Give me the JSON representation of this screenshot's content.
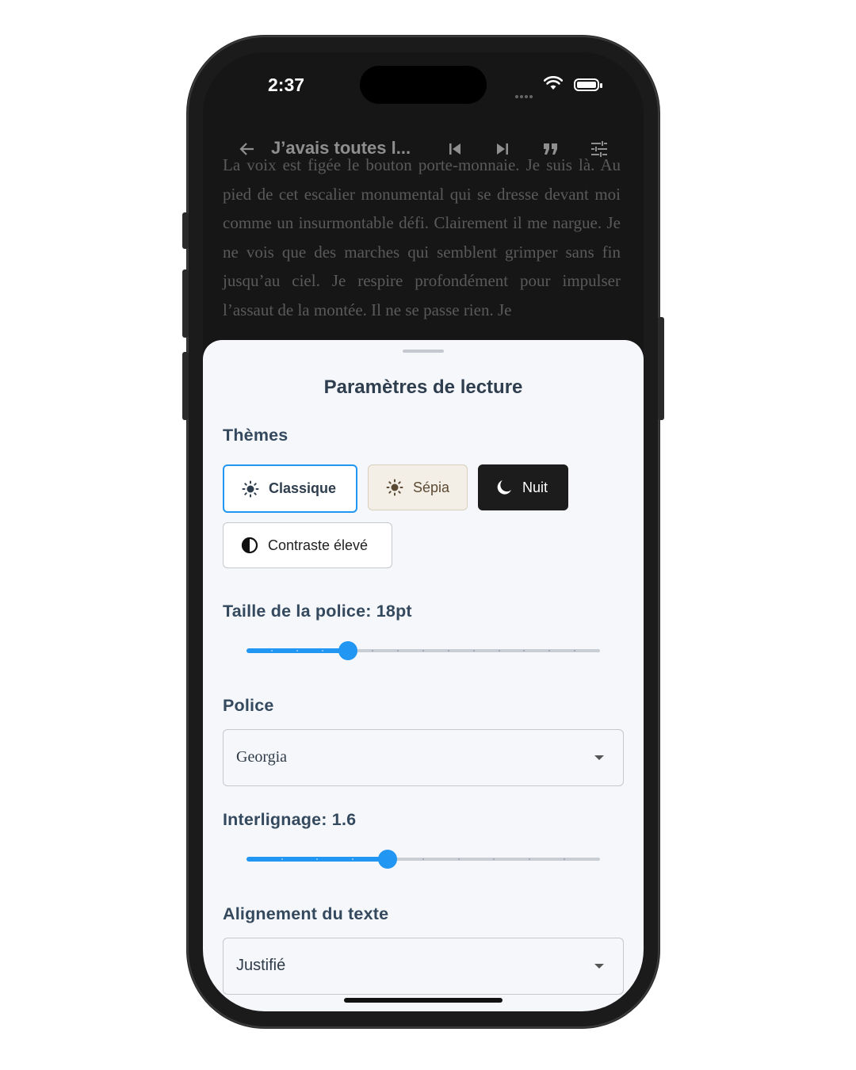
{
  "status_bar": {
    "time": "2:37"
  },
  "top_bar": {
    "back_icon": "arrow-left-icon",
    "title": "J’avais toutes l...",
    "actions": [
      "skip-previous-icon",
      "skip-next-icon",
      "quote-icon",
      "settings-sliders-icon"
    ]
  },
  "reading": {
    "text": "La voix est figée le bouton porte-monnaie. Je suis là. Au pied de cet escalier monumental qui se dresse devant moi comme un insurmontable défi. Clairement il me nargue. Je ne vois que des marches qui semblent grimper sans fin jusqu’au ciel. Je respire profondément pour impulser l’assaut de la montée. Il ne se passe rien. Je"
  },
  "sheet": {
    "title": "Paramètres de lecture",
    "themes_label": "Thèmes",
    "themes": [
      {
        "label": "Classique",
        "icon": "sun-icon",
        "selected": true
      },
      {
        "label": "Sépia",
        "icon": "sun-icon",
        "selected": false
      },
      {
        "label": "Nuit",
        "icon": "moon-icon",
        "selected": false
      },
      {
        "label": "Contraste élevé",
        "icon": "contrast-icon",
        "selected": false
      }
    ],
    "font_size_label": "Taille de la police: 18pt",
    "font_size_slider": {
      "fraction": 0.286
    },
    "font_label": "Police",
    "font_value": "Georgia",
    "line_spacing_label": "Interlignage: 1.6",
    "line_spacing_slider": {
      "fraction": 0.4
    },
    "alignment_label": "Alignement du texte",
    "alignment_value": "Justifié"
  },
  "colors": {
    "accent": "#2196f3",
    "sheet_bg": "#f5f7fa",
    "night_btn": "#1c1c1c",
    "sepia_btn": "#f4efe6"
  }
}
